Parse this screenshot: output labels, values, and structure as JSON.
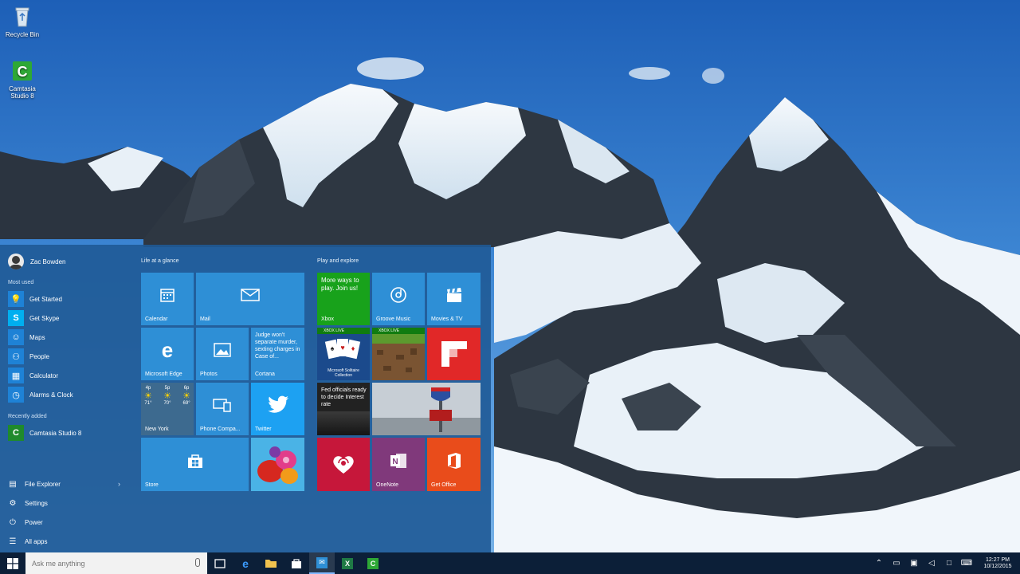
{
  "desktop": {
    "icons": [
      {
        "label": "Recycle Bin",
        "icon": "recycle-bin-icon"
      },
      {
        "label": "Camtasia Studio 8",
        "icon": "camtasia-icon"
      }
    ]
  },
  "start_menu": {
    "user": {
      "name": "Zac Bowden"
    },
    "most_used_label": "Most used",
    "most_used": [
      {
        "label": "Get Started",
        "icon": "lightbulb-icon",
        "color": "#1e82d6"
      },
      {
        "label": "Get Skype",
        "icon": "skype-icon",
        "color": "#00aff0"
      },
      {
        "label": "Maps",
        "icon": "person-icon",
        "color": "#1e82d6"
      },
      {
        "label": "People",
        "icon": "people-icon",
        "color": "#1e82d6"
      },
      {
        "label": "Calculator",
        "icon": "calculator-icon",
        "color": "#1e82d6"
      },
      {
        "label": "Alarms & Clock",
        "icon": "alarm-clock-icon",
        "color": "#1e82d6"
      }
    ],
    "recently_added_label": "Recently added",
    "recently_added": [
      {
        "label": "Camtasia Studio 8",
        "icon": "camtasia-icon",
        "color": "#1f8a2c"
      }
    ],
    "bottom_items": [
      {
        "label": "File Explorer",
        "icon": "file-explorer-icon"
      },
      {
        "label": "Settings",
        "icon": "gear-icon"
      },
      {
        "label": "Power",
        "icon": "power-icon"
      },
      {
        "label": "All apps",
        "icon": "all-apps-icon"
      }
    ],
    "groups": {
      "life": "Life at a glance",
      "play": "Play and explore"
    },
    "tiles": {
      "calendar": "Calendar",
      "mail": "Mail",
      "edge": "Microsoft Edge",
      "photos": "Photos",
      "cortana_text": "Judge won't separate murder, sexting charges in Case of...",
      "cortana": "Cortana",
      "weather_city": "New York",
      "weather_times": [
        "4p",
        "5p",
        "6p"
      ],
      "weather_temps": [
        "71°",
        "70°",
        "69°"
      ],
      "phone": "Phone Compa...",
      "twitter": "Twitter",
      "store": "Store",
      "xbox_text": "More ways to play. Join us!",
      "xbox": "Xbox",
      "groove": "Groove Music",
      "movies": "Movies & TV",
      "xbox_live": "XBOX LIVE",
      "solitaire": "Microsoft Solitaire Collection",
      "news_text": "Fed officials ready to decide Interest rate",
      "onenote": "OneNote",
      "get_office": "Get Office"
    }
  },
  "taskbar": {
    "search_placeholder": "Ask me anything",
    "clock_time": "12:27 PM",
    "clock_date": "10/12/2015",
    "apps": [
      {
        "name": "task-view",
        "active": false
      },
      {
        "name": "edge",
        "active": false
      },
      {
        "name": "file-explorer",
        "active": false
      },
      {
        "name": "store",
        "active": false
      },
      {
        "name": "mail",
        "active": true
      },
      {
        "name": "excel",
        "active": false
      },
      {
        "name": "camtasia",
        "active": false
      }
    ]
  },
  "colors": {
    "tile_blue": "#2e8fd6",
    "xbox_green": "#18a21b",
    "flipboard_red": "#e12828",
    "iheart_red": "#c6173a",
    "onenote_purple": "#80397b",
    "office_orange": "#e94c1b",
    "twitter_blue": "#1da1f2",
    "taskbar": "#0c1f38"
  }
}
